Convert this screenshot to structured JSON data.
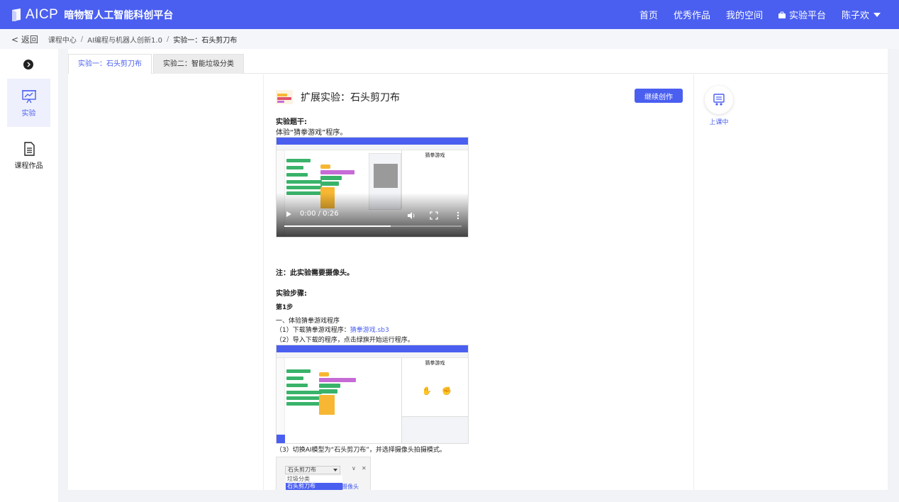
{
  "header": {
    "brand": "AICP",
    "subtitle": "暗物智人工智能科创平台",
    "nav": [
      "首页",
      "优秀作品",
      "我的空间"
    ],
    "platform": "实验平台",
    "user": "陈子欢"
  },
  "breadcrumb": {
    "back": "< 返回",
    "items": [
      "课程中心",
      "AI编程与机器人创新1.0",
      "实验一：石头剪刀布"
    ],
    "separator": "/"
  },
  "sidebar": {
    "items": [
      {
        "label": "实验",
        "icon": "presentation-chart-icon",
        "active": true
      },
      {
        "label": "课程作品",
        "icon": "document-icon",
        "active": false
      }
    ]
  },
  "tabs": [
    {
      "label": "实验一：石头剪刀布",
      "active": true
    },
    {
      "label": "实验二：智能垃圾分类",
      "active": false
    }
  ],
  "doc": {
    "title": "扩展实验：石头剪刀布",
    "continue_button": "继续创作",
    "problem_heading": "实验题干:",
    "problem_text": "体验“猜拳游戏”程序。",
    "video_time": "0:00 / 0:26",
    "video_progress": 0.6,
    "note": "注：此实验需要摄像头。",
    "steps_heading": "实验步骤:",
    "step1": "第1步",
    "step1_line1": "一、体验猜拳游戏程序",
    "step1_line2_prefix": "（1）下载猜拳游戏程序：",
    "step1_link": "猜拳游戏.sb3",
    "step1_line3": "（2）导入下载的程序，点击绿旗开始运行程序。",
    "step1_line4": "（3）切换AI模型为“石头剪刀布”，并选择摄像头拍摄模式。",
    "shot_stage_title": "猜拳游戏",
    "dropdown": {
      "selected": "石头剪刀布",
      "options": [
        "垃圾分类",
        "石头剪刀布"
      ],
      "hint": "摄像头"
    }
  },
  "right_tool": {
    "label": "上课中",
    "icon": "classroom-icon"
  },
  "colors": {
    "primary": "#4a5ff0",
    "background": "#f2f3f7"
  }
}
